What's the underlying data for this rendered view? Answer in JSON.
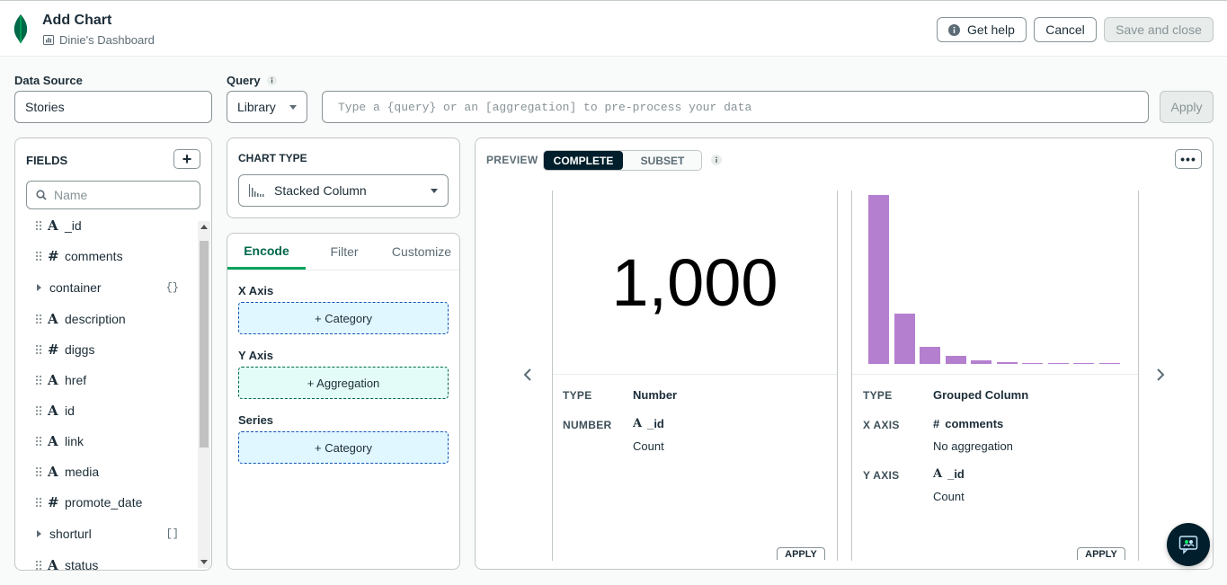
{
  "header": {
    "title": "Add Chart",
    "dashboard": "Dinie's Dashboard",
    "get_help": "Get help",
    "cancel": "Cancel",
    "save_close": "Save and close"
  },
  "datasource": {
    "label": "Data Source",
    "value": "Stories"
  },
  "query": {
    "label": "Query",
    "mode": "Library",
    "placeholder": "Type a {query} or an [aggregation] to pre-process your data",
    "apply": "Apply"
  },
  "fields": {
    "title": "FIELDS",
    "search_placeholder": "Name",
    "items": [
      {
        "type": "A",
        "name": "_id"
      },
      {
        "type": "#",
        "name": "comments"
      },
      {
        "type": "obj",
        "name": "container",
        "badge": "{}"
      },
      {
        "type": "A",
        "name": "description"
      },
      {
        "type": "#",
        "name": "diggs"
      },
      {
        "type": "A",
        "name": "href"
      },
      {
        "type": "A",
        "name": "id"
      },
      {
        "type": "A",
        "name": "link"
      },
      {
        "type": "A",
        "name": "media"
      },
      {
        "type": "#",
        "name": "promote_date"
      },
      {
        "type": "arr",
        "name": "shorturl",
        "badge": "[]"
      },
      {
        "type": "A",
        "name": "status"
      }
    ]
  },
  "chart_type": {
    "label": "CHART TYPE",
    "value": "Stacked Column"
  },
  "encode": {
    "tabs": [
      "Encode",
      "Filter",
      "Customize"
    ],
    "x_axis": {
      "label": "X Axis",
      "drop": "+ Category"
    },
    "y_axis": {
      "label": "Y Axis",
      "drop": "+ Aggregation"
    },
    "series": {
      "label": "Series",
      "drop": "+ Category"
    }
  },
  "preview": {
    "label": "PREVIEW",
    "complete": "COMPLETE",
    "subset": "SUBSET",
    "cards": [
      {
        "big_number": "1,000",
        "type_k": "TYPE",
        "type_v": "Number",
        "k2": "NUMBER",
        "field_icon": "A",
        "field": "_id",
        "agg": "Count",
        "apply": "APPLY"
      },
      {
        "type_k": "TYPE",
        "type_v": "Grouped Column",
        "x_k": "X AXIS",
        "x_icon": "#",
        "x_field": "comments",
        "x_agg": "No aggregation",
        "y_k": "Y AXIS",
        "y_icon": "A",
        "y_field": "_id",
        "y_agg": "Count",
        "apply": "APPLY"
      }
    ]
  },
  "chart_data": {
    "type": "bar",
    "values": [
      100,
      30,
      10,
      5,
      2,
      1,
      0.5,
      0.5,
      0,
      0.3
    ],
    "color": "#b57fcf"
  },
  "colors": {
    "brand": "#00684a",
    "dark": "#001e2b",
    "bar": "#b57fcf"
  }
}
